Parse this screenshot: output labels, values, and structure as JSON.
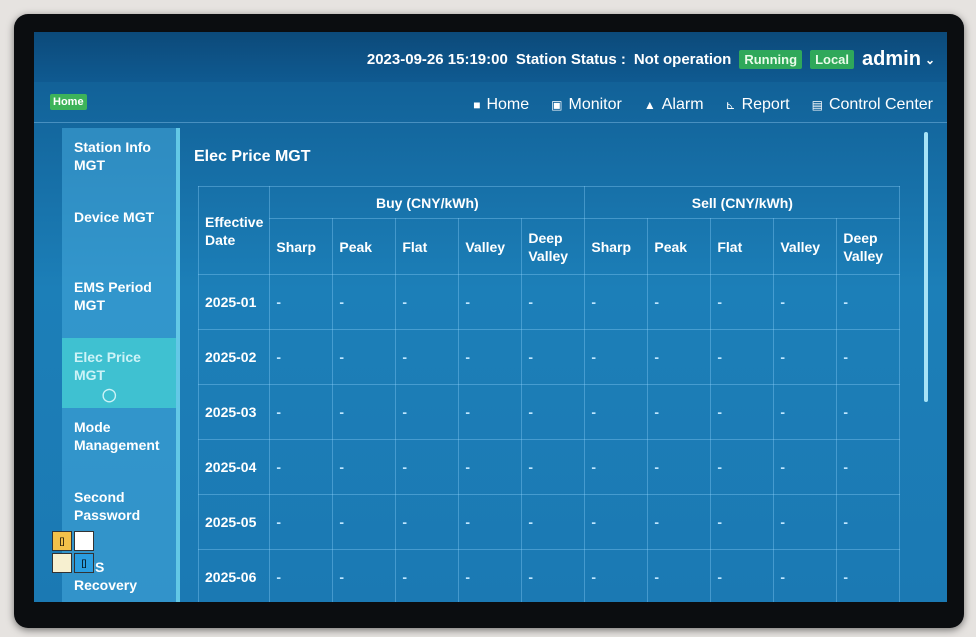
{
  "header": {
    "datetime": "2023-09-26 15:19:00",
    "station_status_label": "Station Status :",
    "station_status_value": "Not operation",
    "running_badge": "Running",
    "local_badge": "Local",
    "user": "admin"
  },
  "nav": {
    "home_badge": "Home",
    "items": [
      {
        "label": "Home",
        "icon": "home-icon"
      },
      {
        "label": "Monitor",
        "icon": "monitor-icon"
      },
      {
        "label": "Alarm",
        "icon": "alarm-icon"
      },
      {
        "label": "Report",
        "icon": "report-icon"
      },
      {
        "label": "Control Center",
        "icon": "control-center-icon"
      }
    ]
  },
  "sidebar": {
    "items": [
      {
        "label": "Station Info MGT"
      },
      {
        "label": "Device MGT"
      },
      {
        "label": "EMS Period MGT"
      },
      {
        "label": "Elec Price MGT",
        "active": true
      },
      {
        "label": "Mode Management"
      },
      {
        "label": "Second Password"
      },
      {
        "label": "EMS Recovery"
      }
    ]
  },
  "page": {
    "title": "Elec Price MGT"
  },
  "table": {
    "date_header": "Effective Date",
    "buy_group": "Buy (CNY/kWh)",
    "sell_group": "Sell (CNY/kWh)",
    "columns": [
      "Sharp",
      "Peak",
      "Flat",
      "Valley",
      "Deep Valley"
    ],
    "rows": [
      {
        "date": "2025-01",
        "buy": [
          "-",
          "-",
          "-",
          "-",
          "-"
        ],
        "sell": [
          "-",
          "-",
          "-",
          "-",
          "-"
        ]
      },
      {
        "date": "2025-02",
        "buy": [
          "-",
          "-",
          "-",
          "-",
          "-"
        ],
        "sell": [
          "-",
          "-",
          "-",
          "-",
          "-"
        ]
      },
      {
        "date": "2025-03",
        "buy": [
          "-",
          "-",
          "-",
          "-",
          "-"
        ],
        "sell": [
          "-",
          "-",
          "-",
          "-",
          "-"
        ]
      },
      {
        "date": "2025-04",
        "buy": [
          "-",
          "-",
          "-",
          "-",
          "-"
        ],
        "sell": [
          "-",
          "-",
          "-",
          "-",
          "-"
        ]
      },
      {
        "date": "2025-05",
        "buy": [
          "-",
          "-",
          "-",
          "-",
          "-"
        ],
        "sell": [
          "-",
          "-",
          "-",
          "-",
          "-"
        ]
      },
      {
        "date": "2025-06",
        "buy": [
          "-",
          "-",
          "-",
          "-",
          "-"
        ],
        "sell": [
          "-",
          "-",
          "-",
          "-",
          "-"
        ]
      }
    ]
  },
  "colors": {
    "accent": "#3fc1d1",
    "running": "#2fa85a",
    "screen_bg": "#1c7fb8"
  }
}
